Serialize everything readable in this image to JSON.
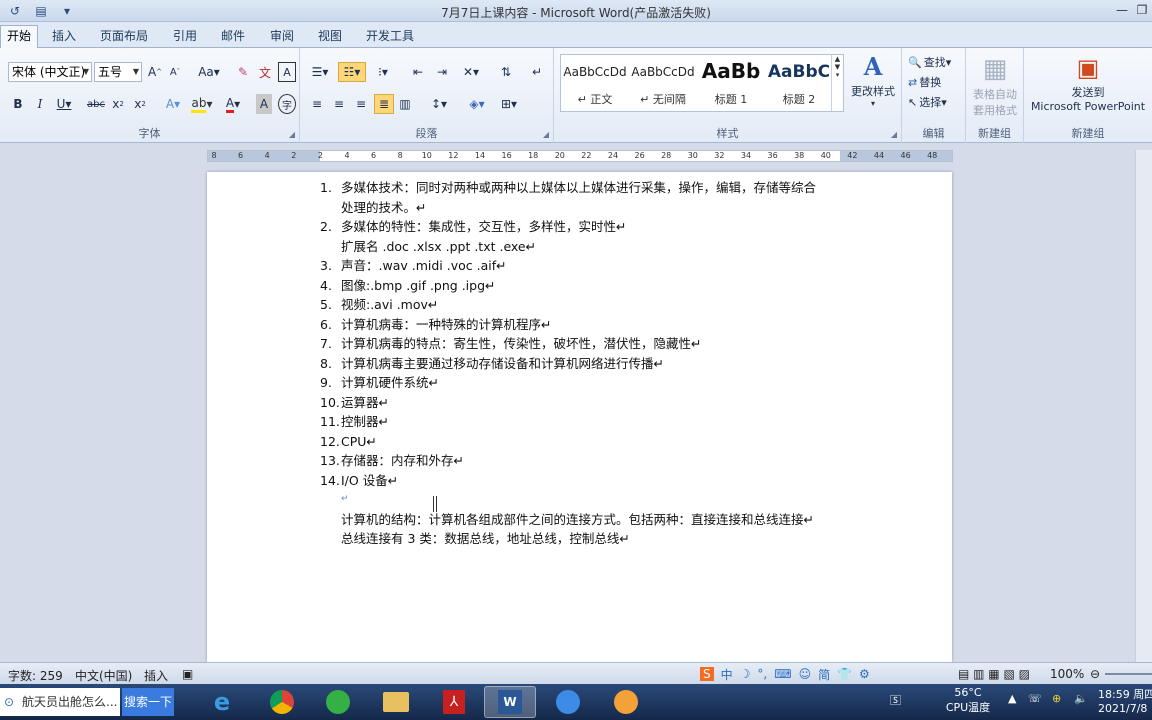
{
  "window": {
    "title": "7月7日上课内容 - Microsoft Word(产品激活失败)"
  },
  "tabs": [
    {
      "label": "开始",
      "active": true
    },
    {
      "label": "插入"
    },
    {
      "label": "页面布局"
    },
    {
      "label": "引用"
    },
    {
      "label": "邮件"
    },
    {
      "label": "审阅"
    },
    {
      "label": "视图"
    },
    {
      "label": "开发工具"
    }
  ],
  "ribbon": {
    "font_group": {
      "label": "字体",
      "font_name": "宋体 (中文正)",
      "font_size": "五号"
    },
    "paragraph_group": {
      "label": "段落"
    },
    "styles_group": {
      "label": "样式",
      "styles": [
        {
          "sample": "AaBbCcDd",
          "name": "↵ 正文"
        },
        {
          "sample": "AaBbCcDd",
          "name": "↵ 无间隔"
        },
        {
          "sample": "AaBb",
          "name": "标题 1"
        },
        {
          "sample": "AaBbC",
          "name": "标题 2"
        }
      ],
      "change_styles": "更改样式"
    },
    "editing_group": {
      "label": "编辑",
      "find": "查找",
      "replace": "替换",
      "select": "选择"
    },
    "new_group_1": {
      "label": "新建组",
      "btn_line1": "表格自动",
      "btn_line2": "套用格式"
    },
    "new_group_2": {
      "label": "新建组",
      "btn_line1": "发送到",
      "btn_line2": "Microsoft PowerPoint"
    }
  },
  "ruler": {
    "ticks": [
      "8",
      "6",
      "4",
      "2",
      "2",
      "4",
      "6",
      "8",
      "10",
      "12",
      "14",
      "16",
      "18",
      "20",
      "22",
      "24",
      "26",
      "28",
      "30",
      "32",
      "34",
      "36",
      "38",
      "40",
      "42",
      "44",
      "46",
      "48"
    ]
  },
  "document": {
    "list": [
      {
        "num": "1.",
        "lines": [
          "多媒体技术：同时对两种或两种以上媒体以上媒体进行采集，操作，编辑，存储等综合",
          "处理的技术。↵"
        ]
      },
      {
        "num": "2.",
        "lines": [
          "多媒体的特性：集成性，交互性，多样性，实时性↵",
          "扩展名 .doc   .xlsx     .ppt      .txt   .exe↵"
        ]
      },
      {
        "num": "3.",
        "lines": [
          "声音：.wav     .midi .voc .aif↵"
        ]
      },
      {
        "num": "4.",
        "lines": [
          "图像:.bmp    .gif    .png .ipg↵"
        ]
      },
      {
        "num": "5.",
        "lines": [
          "视频:.avi .mov↵"
        ]
      },
      {
        "num": "6.",
        "lines": [
          "计算机病毒：一种特殊的计算机程序↵"
        ]
      },
      {
        "num": "7.",
        "lines": [
          "计算机病毒的特点：寄生性，传染性，破坏性，潜伏性，隐藏性↵"
        ]
      },
      {
        "num": "8.",
        "lines": [
          "计算机病毒主要通过移动存储设备和计算机网络进行传播↵"
        ]
      },
      {
        "num": "9.",
        "lines": [
          "计算机硬件系统↵"
        ]
      },
      {
        "num": "10.",
        "lines": [
          "运算器↵"
        ]
      },
      {
        "num": "11.",
        "lines": [
          "控制器↵"
        ]
      },
      {
        "num": "12.",
        "lines": [
          "CPU↵"
        ]
      },
      {
        "num": "13.",
        "lines": [
          "存储器：内存和外存↵"
        ]
      },
      {
        "num": "14.",
        "lines": [
          "I/O 设备↵"
        ]
      }
    ],
    "after_list": [
      "↵",
      "计算机的结构：计算机各组成部件之间的连接方式。包括两种：直接连接和总线连接↵",
      "总线连接有 3 类：数据总线，地址总线，控制总线↵"
    ]
  },
  "statusbar": {
    "word_count": "字数: 259",
    "language": "中文(中国)",
    "insert_mode": "插入",
    "ime": [
      "中",
      "简"
    ],
    "zoom": "100%"
  },
  "taskbar": {
    "search_text": "航天员出舱怎么...",
    "search_button": "搜索一下",
    "cpu_temp": "56°C",
    "cpu_label": "CPU温度",
    "time": "18:59 周四",
    "date": "2021/7/8"
  }
}
